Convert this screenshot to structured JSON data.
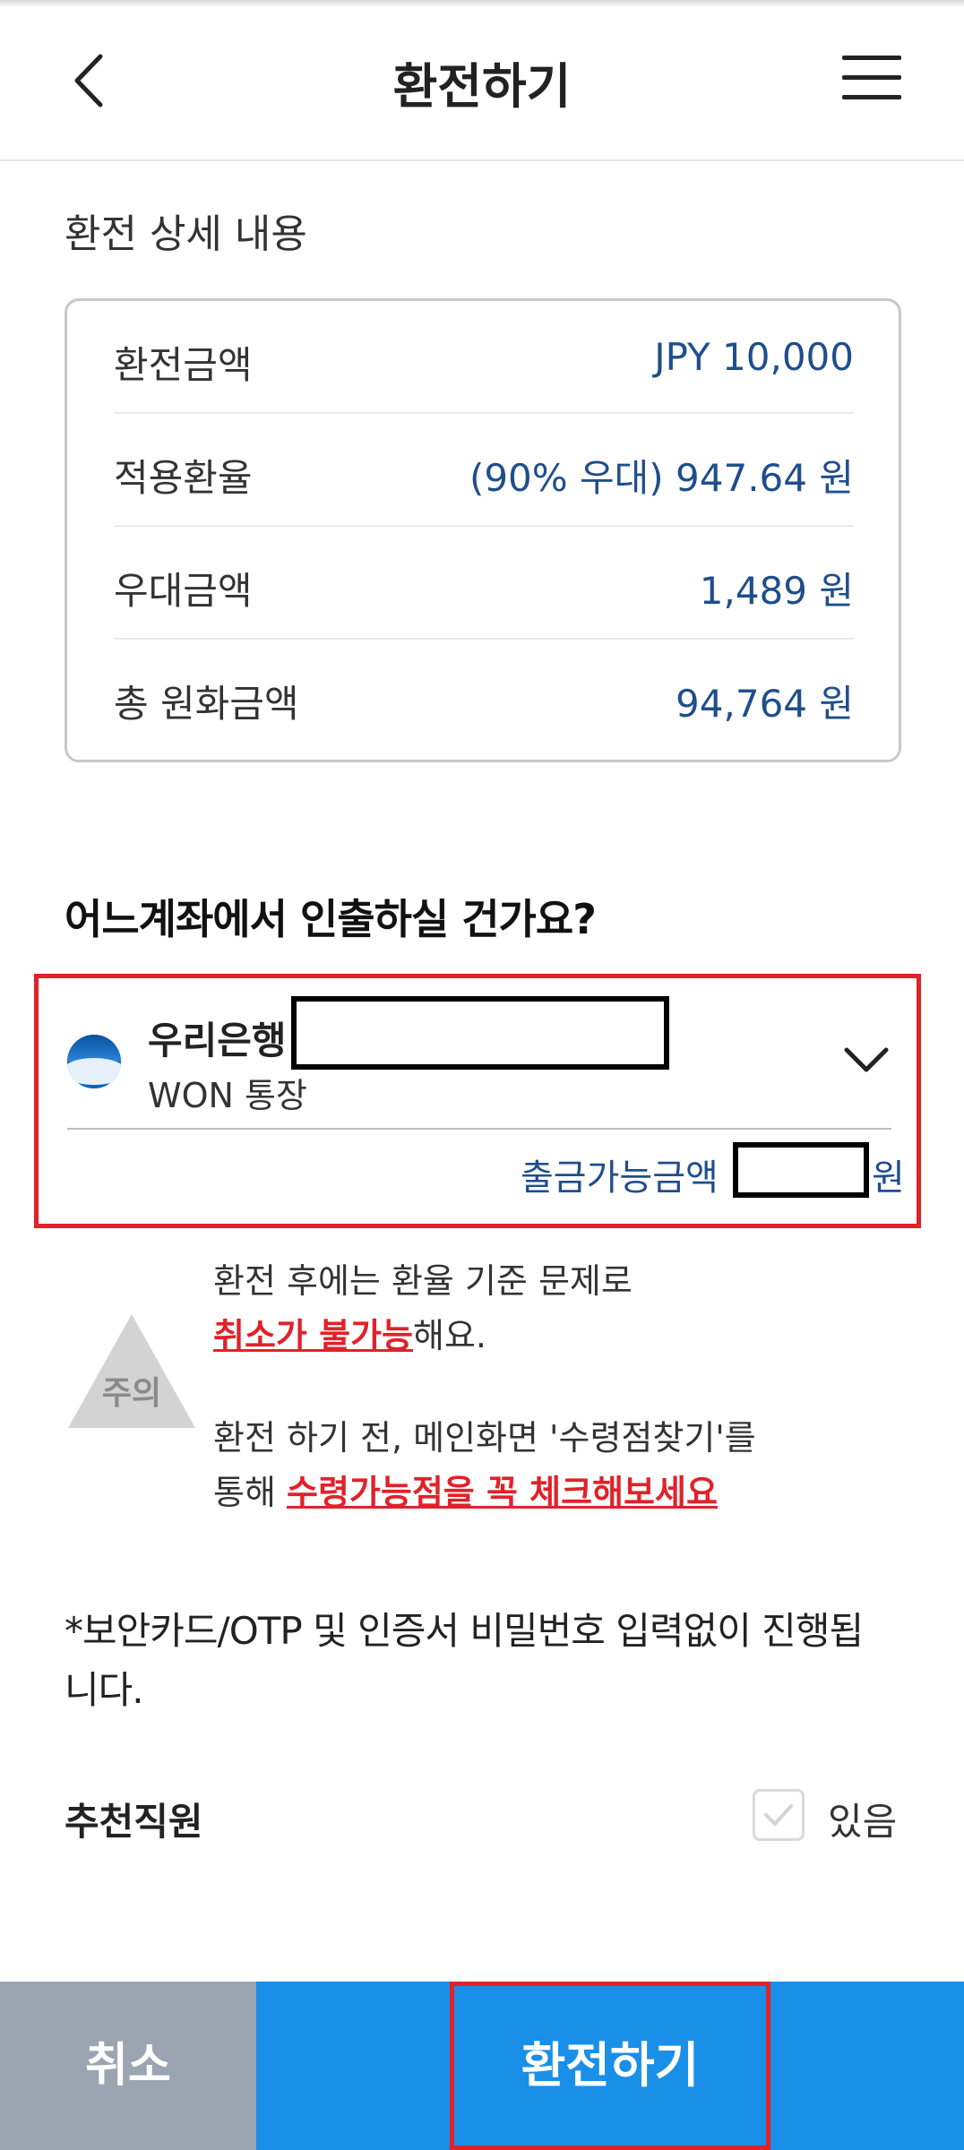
{
  "header": {
    "title": "환전하기",
    "back_icon": "chevron-left-icon",
    "menu_icon": "hamburger-menu-icon"
  },
  "details": {
    "section_title": "환전 상세 내용",
    "rows": [
      {
        "label": "환전금액",
        "value": "JPY 10,000"
      },
      {
        "label": "적용환율",
        "value": "(90% 우대) 947.64 원"
      },
      {
        "label": "우대금액",
        "value": "1,489 원"
      },
      {
        "label": "총 원화금액",
        "value": "94,764 원"
      }
    ]
  },
  "account": {
    "question": "어느계좌에서 인출하실 건가요?",
    "bank_name": "우리은행",
    "account_type": "WON 통장",
    "available_label": "출금가능금액",
    "available_unit": "원"
  },
  "warning": {
    "badge": "주의",
    "line1": "환전 후에는 환율 기준 문제로",
    "line2_red": "취소가 불가능",
    "line2_suffix": "해요.",
    "line3": "환전 하기 전, 메인화면 '수령점찾기'를",
    "line4_prefix": "통해 ",
    "line4_red": "수령가능점을 꼭 체크해보세요"
  },
  "notice": "*보안카드/OTP 및 인증서 비밀번호 입력없이 진행됩니다.",
  "recommend": {
    "label": "추천직원",
    "checkbox_label": "있음"
  },
  "footer": {
    "cancel_label": "취소",
    "exchange_label": "환전하기"
  },
  "colors": {
    "accent_blue": "#1a8fe8",
    "value_navy": "#1f4e8c",
    "highlight_red": "#e0222a",
    "cancel_gray": "#9aa5b1"
  }
}
